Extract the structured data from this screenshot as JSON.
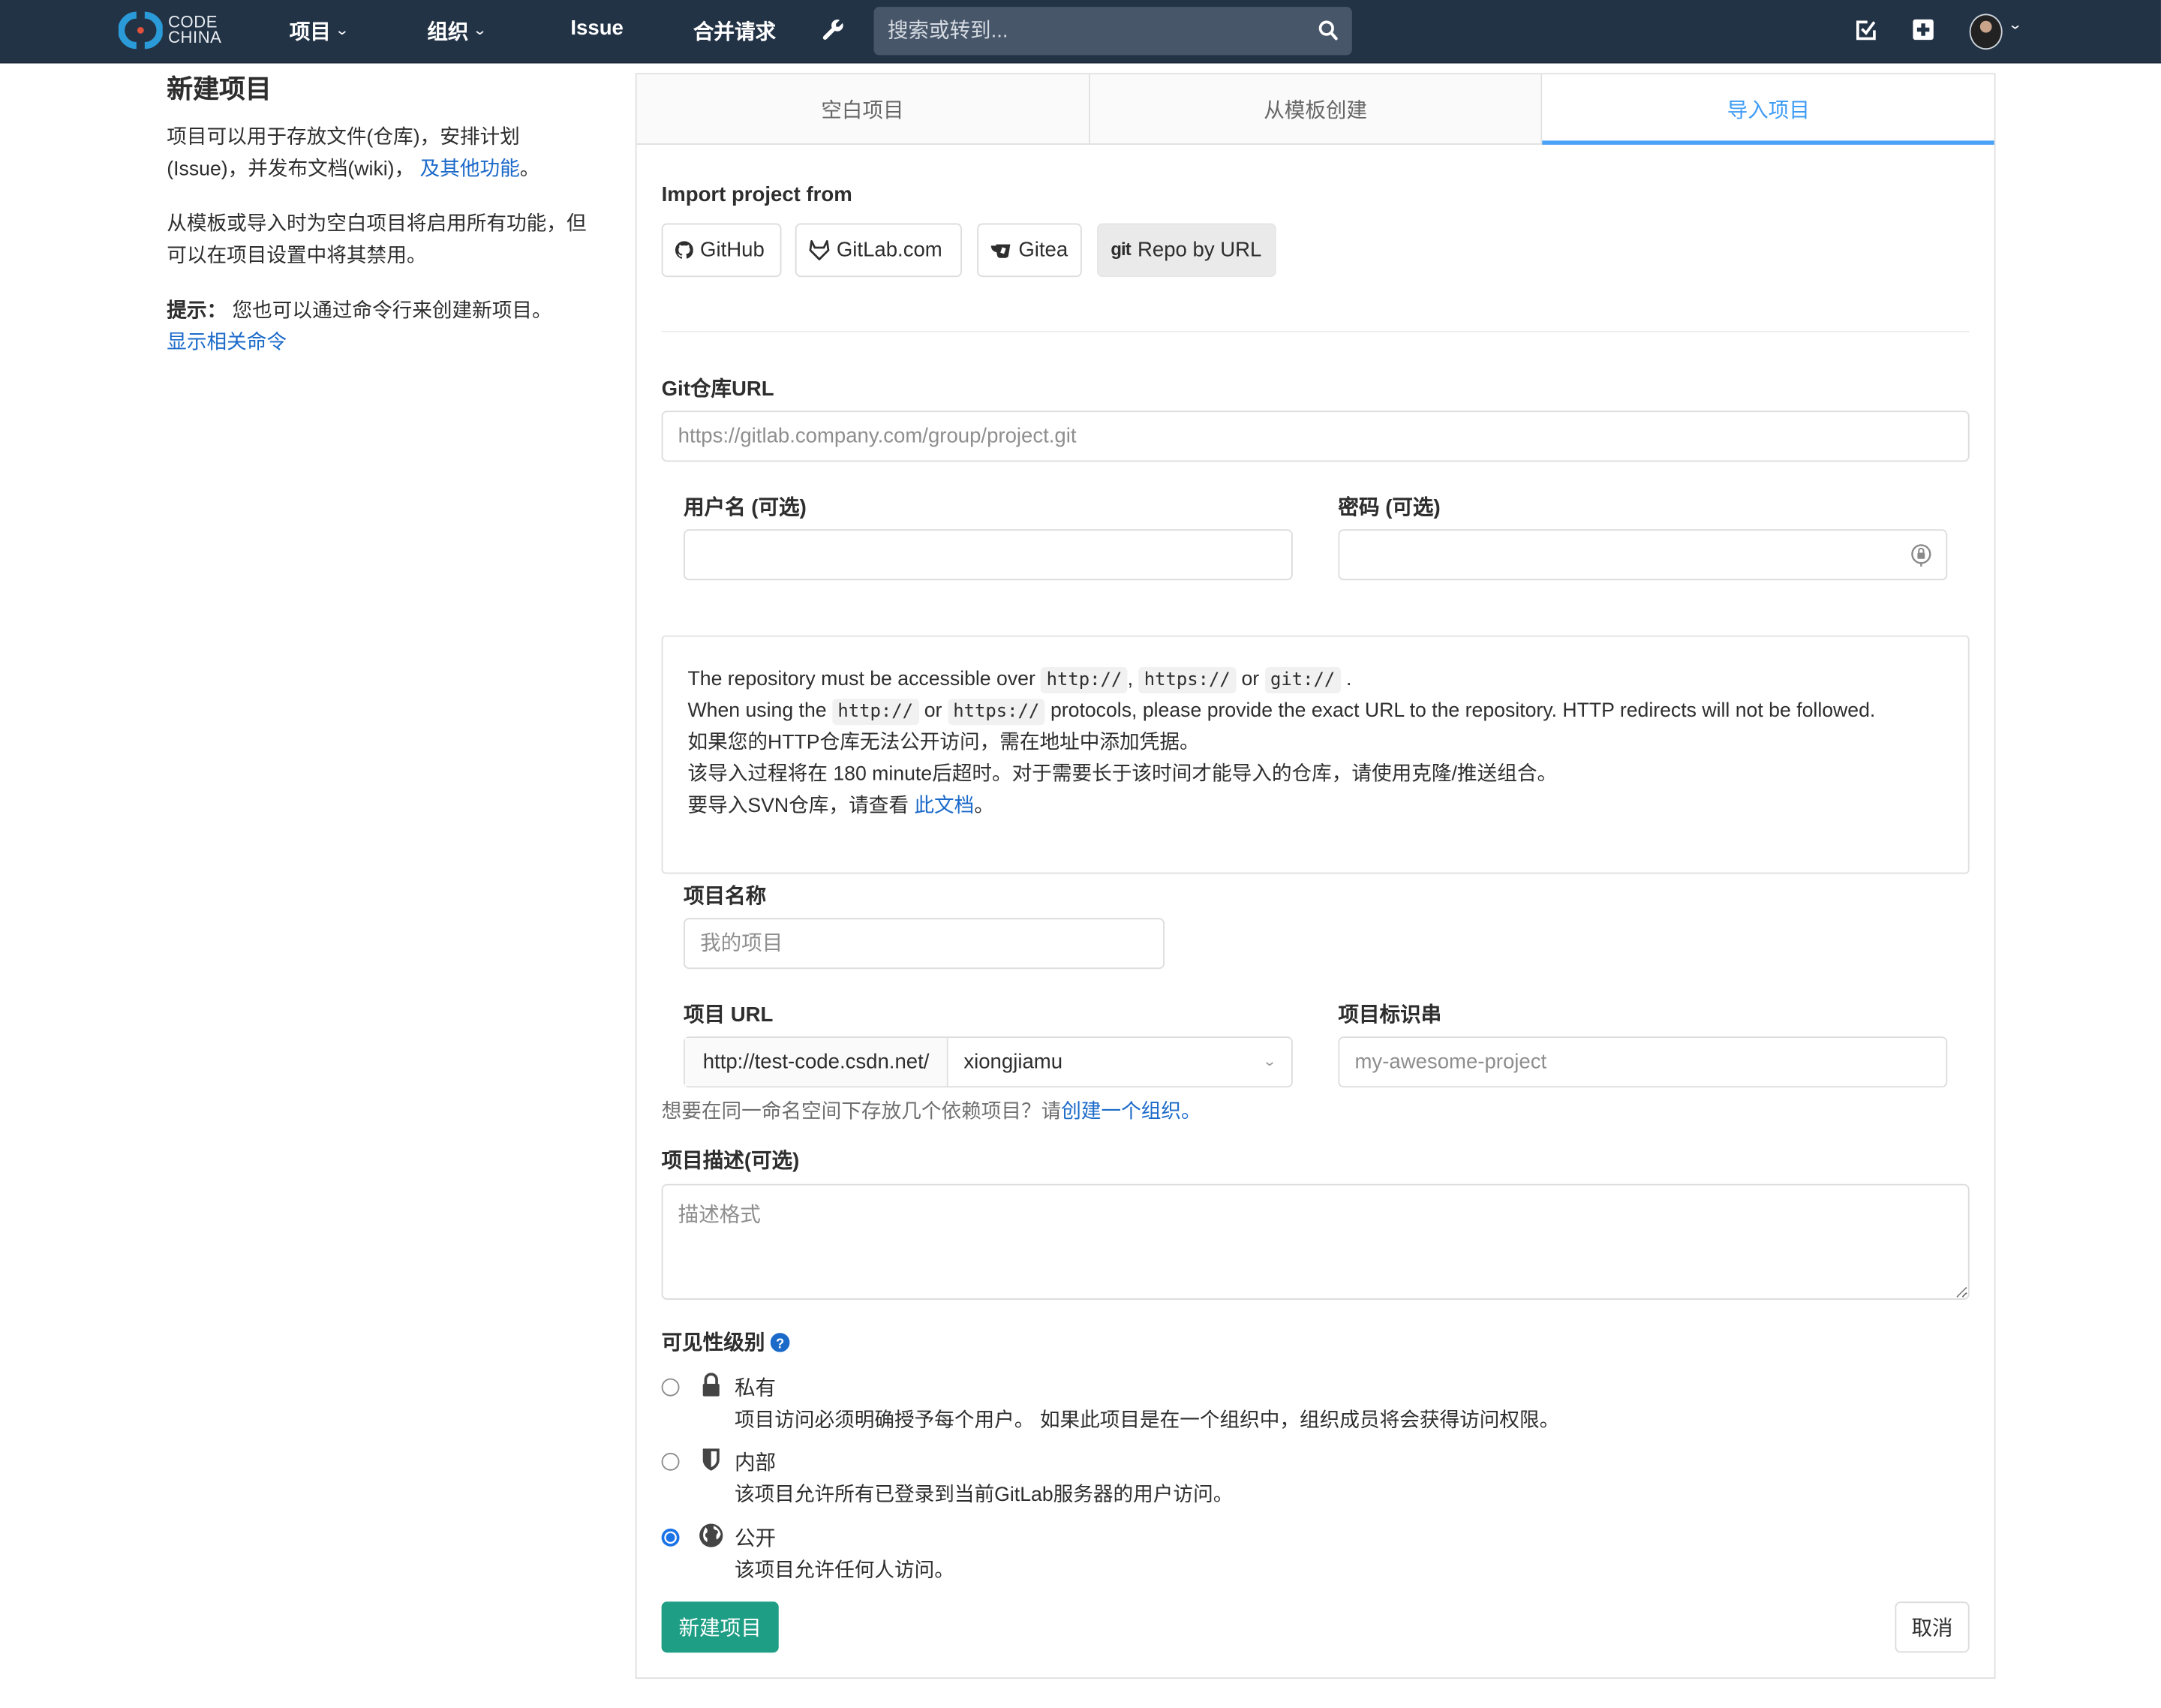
{
  "header": {
    "logo_line1": "CODE",
    "logo_line2": "CHINA",
    "nav": [
      {
        "label": "项目",
        "has_dropdown": true
      },
      {
        "label": "组织",
        "has_dropdown": true
      },
      {
        "label": "Issue",
        "has_dropdown": false
      },
      {
        "label": "合并请求",
        "has_dropdown": false
      }
    ],
    "search_placeholder": "搜索或转到...",
    "icons": [
      "wrench-icon",
      "todo-icon",
      "plus-square-icon",
      "avatar"
    ]
  },
  "sidebar": {
    "title": "新建项目",
    "para1_text": "项目可以用于存放文件(仓库)，安排计划(Issue)，并发布文档(wiki)，",
    "para1_link": "及其他功能",
    "para1_end": "。",
    "para2": "从模板或导入时为空白项目将启用所有功能，但可以在项目设置中将其禁用。",
    "tip_label": "提示：",
    "tip_text": "您也可以通过命令行来创建新项目。",
    "tip_link": "显示相关命令"
  },
  "tabs": [
    {
      "label": "空白项目",
      "active": false
    },
    {
      "label": "从模板创建",
      "active": false
    },
    {
      "label": "导入项目",
      "active": true
    }
  ],
  "import": {
    "label": "Import project from",
    "sources": [
      {
        "label": "GitHub",
        "icon": "github-icon"
      },
      {
        "label": "GitLab.com",
        "icon": "gitlab-icon"
      },
      {
        "label": "Gitea",
        "icon": "gitea-icon"
      },
      {
        "label": "Repo by URL",
        "icon": "git-icon",
        "icon_text": "git",
        "active": true
      }
    ]
  },
  "repo": {
    "url_label": "Git仓库URL",
    "url_placeholder": "https://gitlab.company.com/group/project.git",
    "username_label": "用户名 (可选)",
    "username_value": "",
    "password_label": "密码 (可选)",
    "password_value": ""
  },
  "info": {
    "l1_pre": "The repository must be accessible over ",
    "code_http": "http://",
    "comma": ",",
    "code_https": "https://",
    "or": "or",
    "code_git": "git://",
    "period": ".",
    "l2_pre": "When using the ",
    "l2_post": " protocols, please provide the exact URL to the repository. HTTP redirects will not be followed.",
    "l3": "如果您的HTTP仓库无法公开访问，需在地址中添加凭据。",
    "l4": "该导入过程将在 180 minute后超时。对于需要长于该时间才能导入的仓库，请使用克隆/推送组合。",
    "l5_pre": "要导入SVN仓库，请查看 ",
    "l5_link": "此文档",
    "l5_end": "。"
  },
  "project": {
    "name_label": "项目名称",
    "name_placeholder": "我的项目",
    "url_label": "项目 URL",
    "url_prefix": "http://test-code.csdn.net/",
    "namespace_value": "xiongjiamu",
    "slug_label": "项目标识串",
    "slug_placeholder": "my-awesome-project",
    "hint_text": "想要在同一命名空间下存放几个依赖项目？请",
    "hint_link": "创建一个组织。",
    "desc_label": "项目描述(可选)",
    "desc_placeholder": "描述格式"
  },
  "visibility": {
    "label": "可见性级别",
    "options": [
      {
        "title": "私有",
        "desc": "项目访问必须明确授予每个用户。 如果此项目是在一个组织中，组织成员将会获得访问权限。",
        "icon": "lock-icon",
        "selected": false
      },
      {
        "title": "内部",
        "desc": "该项目允许所有已登录到当前GitLab服务器的用户访问。",
        "icon": "shield-icon",
        "selected": false
      },
      {
        "title": "公开",
        "desc": "该项目允许任何人访问。",
        "icon": "globe-icon",
        "selected": true
      }
    ]
  },
  "actions": {
    "create_label": "新建项目",
    "cancel_label": "取消"
  },
  "colors": {
    "topbar": "#233346",
    "accent": "#3d9bf5",
    "link": "#1b6ac9",
    "create_button": "#1e9e84"
  }
}
